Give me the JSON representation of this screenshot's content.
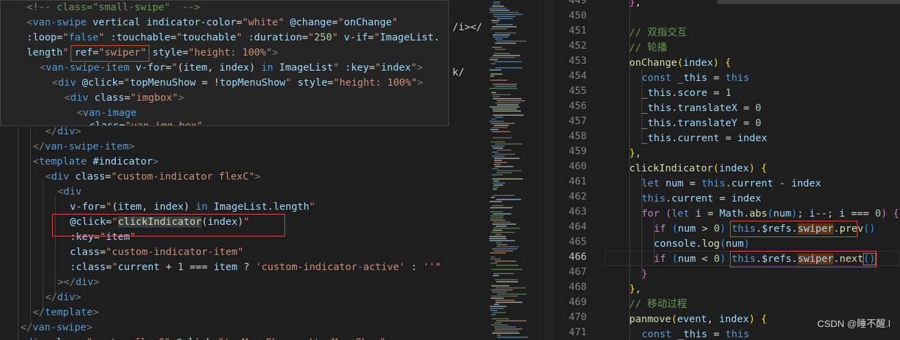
{
  "left": {
    "hover": [
      [
        "<!-- class=\"small-swipe\"  -->"
      ],
      [
        "<van-swipe vertical indicator-color=\"white\" @change=\"onChange\""
      ],
      [
        ":loop=\"false\" :touchable=\"touchable\" :duration=\"250\" v-if=\"ImageList."
      ],
      [
        "length\" ",
        "ref=\"swiper\"",
        " style=\"height: 100%\">"
      ],
      [
        "<van-swipe-item v-for=\"(item, index) in ImageList\" :key=\"index\">"
      ],
      [
        "<div @click=\"topMenuShow = !topMenuShow\" style=\"height: 100%\">"
      ],
      [
        "<div class=\"imgbox\">"
      ],
      [
        "<van-image"
      ],
      [
        "class=\"van-img-box\""
      ]
    ],
    "behind_right": [
      "/i></",
      "",
      "/",
      "",
      "k/"
    ],
    "code": [
      "</div>",
      "</van-swipe-item>",
      "<template #indicator>",
      "<div class=\"custom-indicator flexC\">",
      "<div",
      "v-for=\"(item, index) in ImageList.length\"",
      "@click=\"clickIndicator(index)\"",
      ":key=\"item\"",
      "class=\"custom-indicator-item\"",
      ":class=\"current + 1 === item ? 'custom-indicator-active' : ''\"",
      "></div>",
      "</div>",
      "</template>",
      "</van-swipe>",
      "<div class=\"custom-flexC\" @click=\"topMenuShow = !topMenuShow\" ..."
    ]
  },
  "right": {
    "line_numbers": [
      "449",
      "450",
      "451",
      "452",
      "453",
      "454",
      "455",
      "456",
      "457",
      "458",
      "459",
      "460",
      "461",
      "462",
      "463",
      "464",
      "465",
      "466",
      "467",
      "468",
      "469",
      "470",
      "471"
    ],
    "active_line": "466",
    "code": [
      "},",
      "",
      "// 双指交互",
      "// 轮播",
      "onChange(index) {",
      "const _this = this",
      "_this.score = 1",
      "_this.translateX = 0",
      "_this.translateY = 0",
      "_this.current = index",
      "},",
      "clickIndicator(index) {",
      "let num = this.current - index",
      "this.current = index",
      "for (let i = Math.abs(num); i--; i === 0) {",
      "if (num > 0) this.$refs.swiper.prev()",
      "console.log(num)",
      "if (num < 0) this.$refs.swiper.next()",
      "}",
      "},",
      "// 移动过程",
      "panmove(event, index) {",
      "const _this = this"
    ]
  },
  "watermark": "CSDN @睡不醒.l",
  "colors": {
    "background": "#1e1e1e",
    "redbox": "#e04848",
    "hover_bg": "#252526"
  }
}
